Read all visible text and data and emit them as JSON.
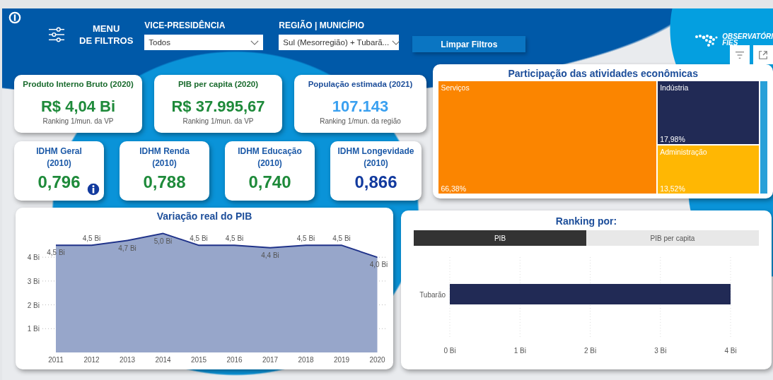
{
  "header": {
    "menu_label": [
      "MENU",
      "DE FILTROS"
    ],
    "filters": [
      {
        "label": "VICE-PRESIDÊNCIA",
        "value": "Todos"
      },
      {
        "label": "REGIÃO | MUNICÍPIO",
        "value": "Sul (Mesorregião) + Tubarã..."
      }
    ],
    "clear_button": "Limpar Filtros",
    "logo": {
      "line_1": "OBSERVATÓRI",
      "line_2": "FIES"
    }
  },
  "kpi_cards": [
    {
      "title": "Produto Interno Bruto (2020)",
      "value": "R$ 4,04 Bi",
      "note": "Ranking 1/mun. da VP",
      "color": "#1e8a3a"
    },
    {
      "title": "PIB per capita (2020)",
      "value": "R$ 37.995,67",
      "note": "Ranking 1/mun. da VP",
      "color": "#1e8a3a"
    },
    {
      "title": "População estimada (2021)",
      "value": "107.143",
      "note": "Ranking 1/mun. da região",
      "color": "#3aa0f0"
    }
  ],
  "idhm_cards": [
    {
      "title": "IDHM Geral",
      "year": "(2010)",
      "value": "0,796",
      "color": "#1e8a3a",
      "info_icon": true
    },
    {
      "title": "IDHM Renda",
      "year": "(2010)",
      "value": "0,788",
      "color": "#1e8a3a",
      "info_icon": false
    },
    {
      "title": "IDHM Educação",
      "year": "(2010)",
      "value": "0,740",
      "color": "#1e8a3a",
      "info_icon": false
    },
    {
      "title": "IDHM Longevidade",
      "year": "(2010)",
      "value": "0,866",
      "color": "#123a9e",
      "info_icon": false
    }
  ],
  "treemap": {
    "title": "Participação das atividades econômicas",
    "items": [
      {
        "name": "Serviços",
        "share": "66,38%",
        "color": "#fb8500"
      },
      {
        "name": "Indústria",
        "share": "17,98%",
        "color": "#212a55"
      },
      {
        "name": "Administração",
        "share": "13,52%",
        "color": "#ffb703"
      },
      {
        "color": "#29a0d8"
      }
    ]
  },
  "pib_chart": {
    "title": "Variação real do PIB",
    "chart_data": {
      "type": "area",
      "categories": [
        "2011",
        "2012",
        "2013",
        "2014",
        "2015",
        "2016",
        "2017",
        "2018",
        "2019",
        "2020"
      ],
      "values": [
        4.5,
        4.5,
        4.7,
        5.0,
        4.5,
        4.5,
        4.4,
        4.5,
        4.5,
        4.0
      ],
      "ylim": [
        0,
        5
      ],
      "grid": true,
      "yticks": [
        {
          "value": 1,
          "label": "1 Bi"
        },
        {
          "value": 2,
          "label": "2 Bi"
        },
        {
          "value": 3,
          "label": "3 Bi"
        },
        {
          "value": 4,
          "label": "4 Bi"
        }
      ],
      "value_labels": [
        "4,5 Bi",
        "4,5 Bi",
        "4,7 Bi",
        "5,0 Bi",
        "4,5 Bi",
        "4,5 Bi",
        "4,4 Bi",
        "4,5 Bi",
        "4,5 Bi",
        "4,0 Bi"
      ]
    }
  },
  "ranking": {
    "title": "Ranking por:",
    "tabs": [
      {
        "label": "PIB",
        "selected": true
      },
      {
        "label": "PIB per capita",
        "selected": false
      }
    ],
    "chart_data": {
      "type": "bar",
      "orientation": "horizontal",
      "categories": [
        "Tubarão"
      ],
      "values": [
        4.0
      ],
      "xlim": [
        0,
        4
      ],
      "grid": true,
      "xticks": [
        {
          "value": 0,
          "label": "0 Bi"
        },
        {
          "value": 1,
          "label": "1 Bi"
        },
        {
          "value": 2,
          "label": "2 Bi"
        },
        {
          "value": 3,
          "label": "3 Bi"
        },
        {
          "value": 4,
          "label": "4 Bi"
        }
      ]
    }
  }
}
